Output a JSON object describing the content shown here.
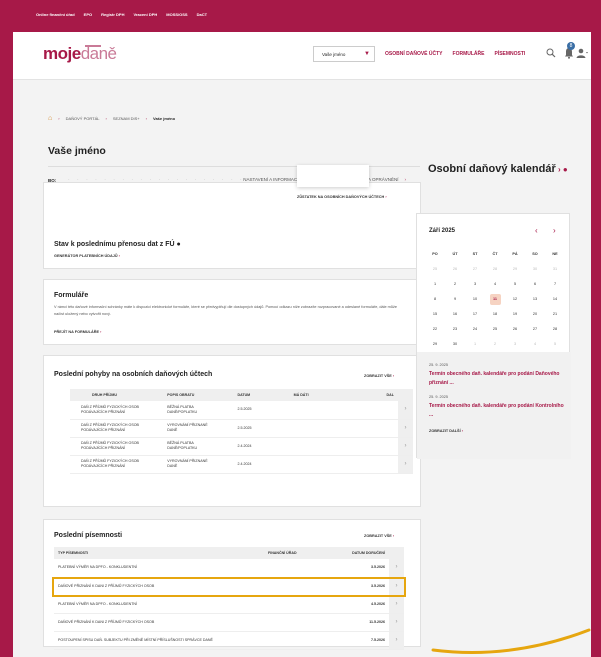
{
  "topbar": {
    "links": [
      "Online finanční úřad",
      "EPO",
      "Registr DPH",
      "Vracení DPH",
      "MOSS/OSS",
      "DaCT"
    ]
  },
  "header": {
    "logo_bold": "moje",
    "logo_light": "daně",
    "name_select": "Vaše jméno",
    "nav": [
      "OSOBNÍ DAŇOVÉ ÚČTY",
      "FORMULÁŘE",
      "PÍSEMNOSTI"
    ],
    "bell_badge": "8",
    "icons": [
      "search-icon",
      "bell-icon",
      "user-icon"
    ]
  },
  "breadcrumb": {
    "items": [
      "DAŇOVÝ PORTÁL",
      "SEZNAM DIS+",
      "Vaše jméno"
    ]
  },
  "page_title": "Vaše jméno",
  "bo_label": "BO:",
  "top_links": [
    "NASTAVENÍ A INFORMACE O SUBJEKTU",
    "UŽIVATELÉ A OPRÁVNĚNÍ"
  ],
  "balance_link": "ZŮSTATEK NA OSOBNÍCH DAŇOVÝCH ÚČTECH",
  "transfer": {
    "title": "Stav k poslednímu přenosu dat z FÚ",
    "link": "GENERÁTOR PLATEBNÍCH ÚDAJŮ"
  },
  "forms": {
    "title": "Formuláře",
    "text": "V rámci této daňové informační schránky máte k dispozici elektronické formuláře, které se předvyplňují dle dostupných údajů. Pomocí odkazu níže zobrazíte rozpracované a odeslané formuláře, dále může načíst uložený nebo vytvořit nový.",
    "link": "PŘEJÍT NA FORMULÁŘE"
  },
  "movements": {
    "title": "Poslední pohyby na osobních daňových účtech",
    "show_all": "ZOBRAZIT VŠE",
    "columns": [
      "DRUH PŘÍJMU",
      "POPIS OBRATU",
      "DATUM",
      "MÁ DÁTI",
      "DAL"
    ],
    "rows": [
      [
        "DAŇ Z PŘÍJMŮ FYZICKÝCH OSOB",
        "PODÁVAJÍCÍCH PŘIZNÁNÍ",
        "BĚŽNÁ PLATBA",
        "DANĚ/POPLATKU",
        "2.5.2025"
      ],
      [
        "DAŇ Z PŘÍJMŮ FYZICKÝCH OSOB",
        "PODÁVAJÍCÍCH PŘIZNÁNÍ",
        "VYROVNÁNÍ PŘIZNANÉ",
        "DANĚ",
        "2.5.2025"
      ],
      [
        "DAŇ Z PŘÍJMŮ FYZICKÝCH OSOB",
        "PODÁVAJÍCÍCH PŘIZNÁNÍ",
        "BĚŽNÁ PLATBA",
        "DANĚ/POPLATKU",
        "2.4.2024"
      ],
      [
        "DAŇ Z PŘÍJMŮ FYZICKÝCH OSOB",
        "PODÁVAJÍCÍCH PŘIZNÁNÍ",
        "VYROVNÁNÍ PŘIZNANÉ",
        "DANĚ",
        "2.4.2024"
      ]
    ]
  },
  "documents": {
    "title": "Poslední písemnosti",
    "show_all": "ZOBRAZIT VŠE",
    "columns": [
      "TYP PÍSEMNOSTI",
      "FINANČNÍ ÚŘAD",
      "DATUM DORUČENÍ"
    ],
    "rows": [
      [
        "PLATEBNÍ VÝMĚR NA DPFO - KONKLUDENTNÍ",
        "",
        "3.5.2026"
      ],
      [
        "DAŇOVÉ PŘIZNÁNÍ K DANI Z PŘÍJMŮ FYZICKÝCH OSOB",
        "",
        "3.5.2026"
      ],
      [
        "PLATEBNÍ VÝMĚR NA DPFO - KONKLUDENTNÍ",
        "",
        "4.5.2026"
      ],
      [
        "DAŇOVÉ PŘIZNÁNÍ K DANI Z PŘÍJMŮ FYZICKÝCH OSOB",
        "",
        "11.5.2026"
      ],
      [
        "POSTOUPENÍ SPISU DAŇ. SUBJEKTU PŘI ZMĚNĚ MÍSTNÍ PŘÍSLUŠNOSTI SPRÁVCE DANĚ",
        "",
        "7.5.2026"
      ]
    ],
    "highlighted_row": 1
  },
  "calendar": {
    "heading": "Osobní daňový kalendář",
    "month": "Září 2025",
    "weekdays": [
      "PO",
      "ÚT",
      "ST",
      "ČT",
      "PÁ",
      "SO",
      "NE"
    ],
    "days": [
      "25",
      "26",
      "27",
      "28",
      "29",
      "30",
      "31",
      "1",
      "2",
      "3",
      "4",
      "5",
      "6",
      "7",
      "8",
      "9",
      "10",
      "11",
      "12",
      "13",
      "14",
      "15",
      "16",
      "17",
      "18",
      "19",
      "20",
      "21",
      "22",
      "23",
      "24",
      "25",
      "26",
      "27",
      "28",
      "29",
      "30",
      "1",
      "2",
      "3",
      "4",
      "5"
    ],
    "today": "11",
    "events": [
      {
        "date": "25. 9. 2025",
        "title": "Termín obecného daň. kalendáře pro podání Daňového přiznání ..."
      },
      {
        "date": "25. 9. 2025",
        "title": "Termín obecného daň. kalendáře pro podání Kontrolního ..."
      }
    ],
    "show_more": "ZOBRAZIT DALŠÍ",
    "accent": "#a71948"
  }
}
